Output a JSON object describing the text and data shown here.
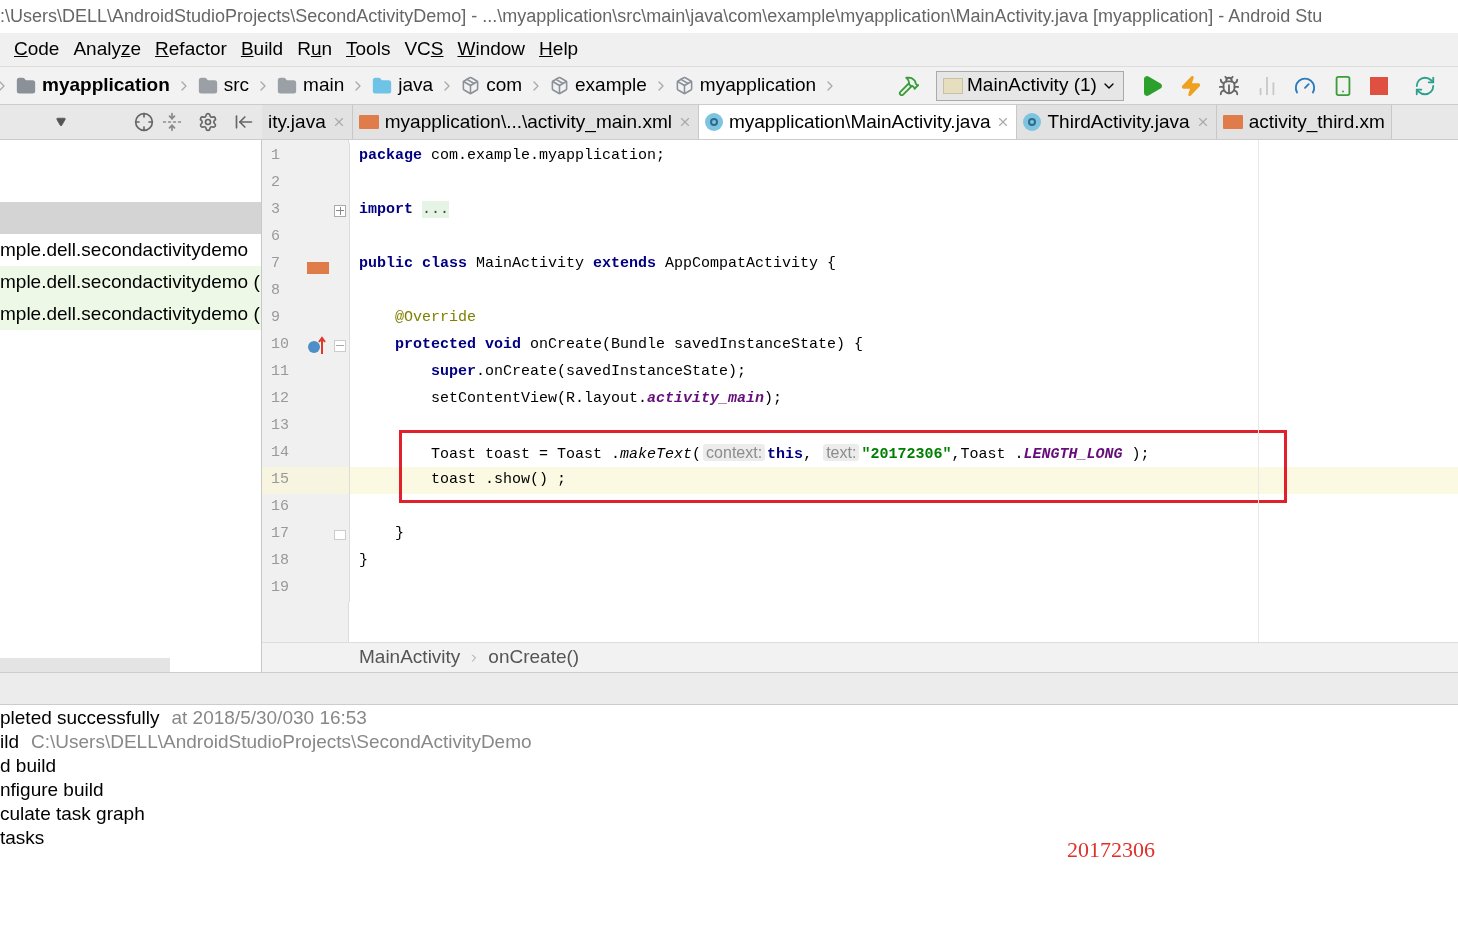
{
  "window": {
    "title": ":\\Users\\DELL\\AndroidStudioProjects\\SecondActivityDemo] - ...\\myapplication\\src\\main\\java\\com\\example\\myapplication\\MainActivity.java [myapplication] - Android Stu"
  },
  "menu": [
    {
      "mnemonic": "C",
      "rest": "ode"
    },
    {
      "before": "Analy",
      "mnemonic": "z",
      "rest": "e"
    },
    {
      "mnemonic": "R",
      "rest": "efactor"
    },
    {
      "mnemonic": "B",
      "rest": "uild"
    },
    {
      "before": "R",
      "mnemonic": "u",
      "rest": "n"
    },
    {
      "mnemonic": "T",
      "rest": "ools"
    },
    {
      "before": "VC",
      "mnemonic": "S"
    },
    {
      "mnemonic": "W",
      "rest": "indow"
    },
    {
      "mnemonic": "H",
      "rest": "elp"
    }
  ],
  "breadcrumbs": [
    {
      "label": "myapplication",
      "kind": "module"
    },
    {
      "label": "src",
      "kind": "folder"
    },
    {
      "label": "main",
      "kind": "folder"
    },
    {
      "label": "java",
      "kind": "source"
    },
    {
      "label": "com",
      "kind": "package"
    },
    {
      "label": "example",
      "kind": "package"
    },
    {
      "label": "myapplication",
      "kind": "package"
    }
  ],
  "run_config": {
    "label": "MainActivity (1)"
  },
  "editor_tabs": [
    {
      "label": "ity.java",
      "kind": "plain",
      "selected": false,
      "closable": true
    },
    {
      "label": "myapplication\\...\\activity_main.xml",
      "kind": "xml",
      "selected": false,
      "closable": true
    },
    {
      "label": "myapplication\\MainActivity.java",
      "kind": "class",
      "selected": true,
      "closable": true
    },
    {
      "label": "ThirdActivity.java",
      "kind": "class",
      "selected": false,
      "closable": true
    },
    {
      "label": "activity_third.xm",
      "kind": "xml",
      "selected": false,
      "closable": false
    }
  ],
  "project_tree": [
    {
      "selected": true,
      "highlighted": false
    },
    {
      "label": "mple.dell.secondactivitydemo",
      "selected": false,
      "highlighted": false
    },
    {
      "label": "mple.dell.secondactivitydemo (",
      "selected": false,
      "highlighted": true
    },
    {
      "label": "mple.dell.secondactivitydemo (",
      "selected": false,
      "highlighted": true
    }
  ],
  "code": {
    "blocks": [
      {
        "kind": "plain",
        "lines": [
          {
            "number": "1",
            "current": false,
            "tokens": [
              {
                "kind": "keyword",
                "text": "package"
              },
              {
                "kind": "plain",
                "text": " com.example.myapplication;"
              }
            ]
          },
          {
            "number": "2",
            "current": false
          },
          {
            "number": "3",
            "current": false,
            "fold_mark": {
              "kind": "expand"
            },
            "tokens": [
              {
                "kind": "keyword",
                "text": "import "
              },
              {
                "kind": "folded",
                "text": "..."
              }
            ]
          },
          {
            "number": "6",
            "current": false
          },
          {
            "number": "7",
            "current": false,
            "gutter_icon": {
              "kind": "layout"
            },
            "tokens": [
              {
                "kind": "keyword",
                "text": "public class"
              },
              {
                "kind": "plain",
                "text": " MainActivity "
              },
              {
                "kind": "keyword",
                "text": "extends"
              },
              {
                "kind": "plain",
                "text": " AppCompatActivity {"
              }
            ]
          },
          {
            "number": "8",
            "current": false
          },
          {
            "number": "9",
            "current": false,
            "tokens": [
              {
                "kind": "annotation",
                "text": "    @Override"
              }
            ]
          },
          {
            "number": "10",
            "current": false,
            "gutter_icon": {
              "kind": "override"
            },
            "fold_mark": {
              "kind": "collapse"
            },
            "tokens": [
              {
                "kind": "keyword",
                "text": "    protected void"
              },
              {
                "kind": "plain",
                "text": " onCreate(Bundle savedInstanceState) {"
              }
            ]
          },
          {
            "number": "11",
            "current": false,
            "tokens": [
              {
                "kind": "keyword",
                "text": "        super"
              },
              {
                "kind": "plain",
                "text": ".onCreate(savedInstanceState);"
              }
            ]
          },
          {
            "number": "12",
            "current": false,
            "tokens": [
              {
                "kind": "plain",
                "text": "        setContentView(R.layout."
              },
              {
                "kind": "field",
                "text": "activity_main"
              },
              {
                "kind": "plain",
                "text": ");"
              }
            ]
          },
          {
            "number": "13",
            "current": false
          }
        ]
      },
      {
        "kind": "boxed",
        "lines": [
          {
            "number": "14",
            "current": false,
            "tokens": [
              {
                "kind": "plain",
                "text": "        Toast toast = Toast ."
              },
              {
                "kind": "static",
                "text": "makeText"
              },
              {
                "kind": "plain",
                "text": "("
              },
              {
                "kind": "hint",
                "text": "context:"
              },
              {
                "kind": "keyword",
                "text": "this"
              },
              {
                "kind": "plain",
                "text": ", "
              },
              {
                "kind": "hint",
                "text": "text:"
              },
              {
                "kind": "string",
                "text": "\"20172306\""
              },
              {
                "kind": "plain",
                "text": ",Toast ."
              },
              {
                "kind": "field",
                "text": "LENGTH_LONG"
              },
              {
                "kind": "plain",
                "text": " );"
              }
            ]
          },
          {
            "number": "15",
            "current": true,
            "tokens": [
              {
                "kind": "plain",
                "text": "        toast .show() ;"
              }
            ]
          }
        ]
      },
      {
        "kind": "plain",
        "lines": [
          {
            "number": "16",
            "current": false
          },
          {
            "number": "17",
            "current": false,
            "fold_mark": {
              "kind": "end"
            },
            "tokens": [
              {
                "kind": "plain",
                "text": "    }"
              }
            ]
          },
          {
            "number": "18",
            "current": false,
            "tokens": [
              {
                "kind": "plain",
                "text": "}"
              }
            ]
          },
          {
            "number": "19",
            "current": false
          }
        ]
      }
    ]
  },
  "editor_breadcrumb": [
    "MainActivity",
    "onCreate()"
  ],
  "build_output": [
    {
      "text": "pleted successfully",
      "detail": "at 2018/5/30/030 16:53"
    },
    {
      "text": "ild",
      "detail": "C:\\Users\\DELL\\AndroidStudioProjects\\SecondActivityDemo"
    },
    {
      "text": "d build"
    },
    {
      "text": "nfigure build"
    },
    {
      "text": "culate task graph"
    },
    {
      "text": "tasks"
    }
  ],
  "toast": {
    "text": "20172306"
  }
}
